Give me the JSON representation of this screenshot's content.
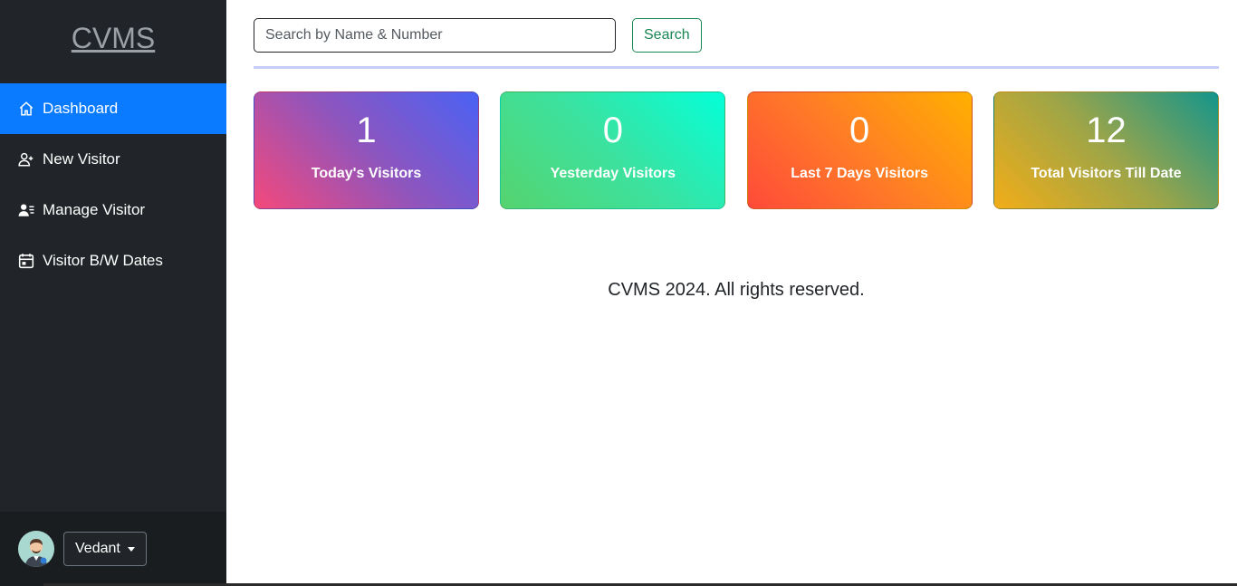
{
  "sidebar": {
    "brand": "CVMS",
    "items": [
      {
        "label": "Dashboard",
        "icon": "home-icon",
        "active": true
      },
      {
        "label": "New Visitor",
        "icon": "user-plus-icon",
        "active": false
      },
      {
        "label": "Manage Visitor",
        "icon": "user-list-icon",
        "active": false
      },
      {
        "label": "Visitor B/W Dates",
        "icon": "calendar-icon",
        "active": false
      }
    ],
    "user": {
      "name": "Vedant",
      "avatar_icon": "user-avatar-icon"
    }
  },
  "search": {
    "placeholder": "Search by Name & Number",
    "value": "",
    "button_label": "Search"
  },
  "stats": [
    {
      "value": "1",
      "label": "Today's Visitors"
    },
    {
      "value": "0",
      "label": "Yesterday Visitors"
    },
    {
      "value": "0",
      "label": "Last 7 Days Visitors"
    },
    {
      "value": "12",
      "label": "Total Visitors Till Date"
    }
  ],
  "footer": {
    "text": "CVMS 2024. All rights reserved."
  },
  "colors": {
    "sidebar_bg": "#212529",
    "active_item": "#0a7bff",
    "search_button": "#198754",
    "divider": "#c7cff7"
  }
}
